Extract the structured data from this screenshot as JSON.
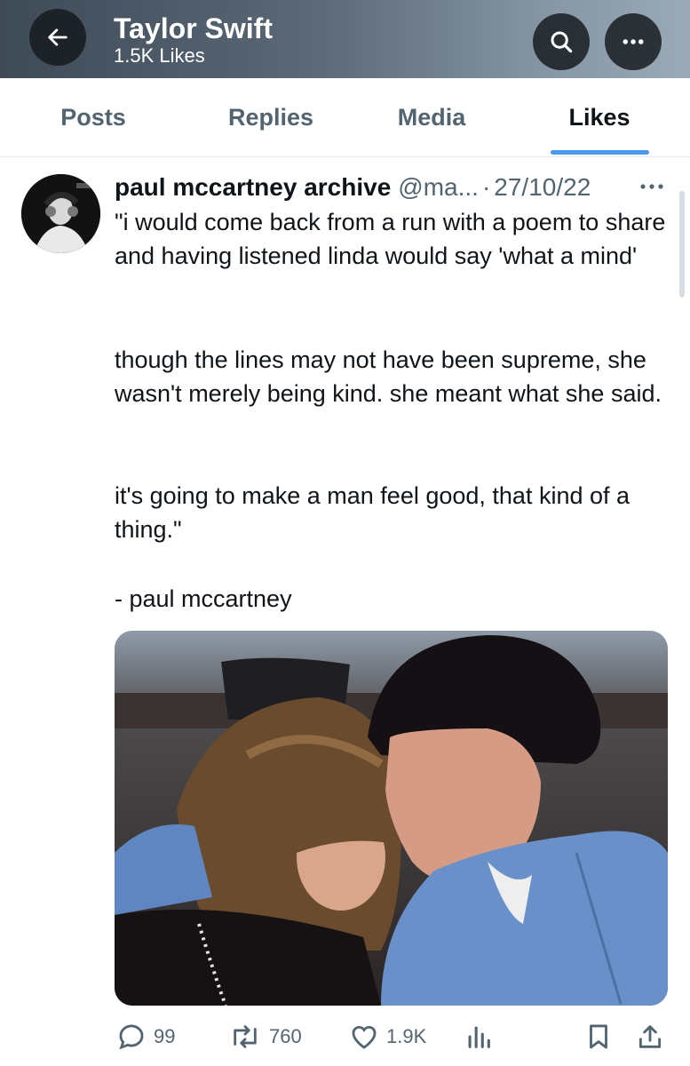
{
  "header": {
    "title": "Taylor Swift",
    "subtitle": "1.5K Likes",
    "back_icon": "back-arrow-icon",
    "search_icon": "search-icon",
    "more_icon": "more-icon"
  },
  "tabs": [
    {
      "label": "Posts",
      "active": false
    },
    {
      "label": "Replies",
      "active": false
    },
    {
      "label": "Media",
      "active": false
    },
    {
      "label": "Likes",
      "active": true
    }
  ],
  "post": {
    "author": "paul mccartney archive",
    "handle": "@ma...",
    "separator": "·",
    "date": "27/10/22",
    "paragraphs": [
      "\"i would come back from a run with a poem to share and having listened linda would say 'what a mind'",
      "though the lines may not have been supreme, she wasn't merely being kind. she meant what she said.",
      "it's going to make a man feel good, that kind of a thing.\"",
      "- paul mccartney"
    ],
    "actions": {
      "replies": "99",
      "reposts": "760",
      "likes": "1.9K"
    }
  },
  "colors": {
    "accent": "#4a99e9",
    "secondary_text": "#536471",
    "primary_text": "#0f1419"
  }
}
